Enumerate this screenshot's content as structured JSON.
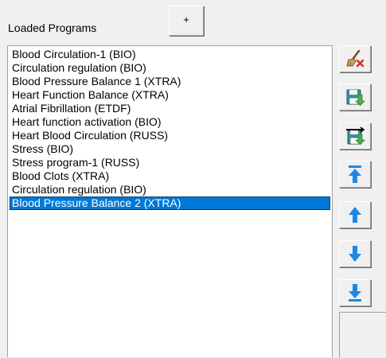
{
  "header": {
    "title": "Loaded Programs",
    "add_label": "+"
  },
  "programs": {
    "items": [
      "Blood Circulation-1 (BIO)",
      "Circulation regulation (BIO)",
      "Blood Pressure Balance 1 (XTRA)",
      "Heart Function Balance (XTRA)",
      "Atrial Fibrillation (ETDF)",
      "Heart function activation (BIO)",
      "Heart Blood Circulation (RUSS)",
      "Stress (BIO)",
      "Stress program-1 (RUSS)",
      "Blood Clots (XTRA)",
      "Circulation regulation (BIO)",
      "Blood Pressure Balance 2 (XTRA)"
    ],
    "selected": "Blood Pressure Balance 2 (XTRA)"
  },
  "toolbar": {
    "buttons": [
      {
        "name": "clear-list-button",
        "icon": "broom-delete-icon"
      },
      {
        "name": "save-list-button",
        "icon": "save-disk-icon"
      },
      {
        "name": "load-list-button",
        "icon": "load-disk-icon"
      },
      {
        "name": "move-to-top-button",
        "icon": "arrow-top-icon"
      },
      {
        "name": "move-up-button",
        "icon": "arrow-up-icon"
      },
      {
        "name": "move-down-button",
        "icon": "arrow-down-icon"
      },
      {
        "name": "move-to-bottom-button",
        "icon": "arrow-bottom-icon"
      }
    ]
  },
  "colors": {
    "window_bg": "#f0f0f0",
    "selection_bg": "#0078d7",
    "selection_fg": "#ffffff",
    "arrow_blue": "#1e88e5",
    "disk_teal": "#3a8f9a",
    "disk_green": "#4caf50",
    "delete_red": "#d32f2f"
  }
}
